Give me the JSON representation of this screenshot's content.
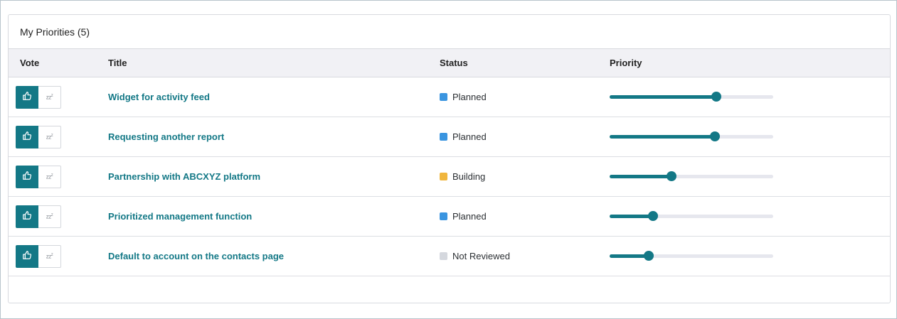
{
  "panel": {
    "title": "My Priorities (5)"
  },
  "columns": {
    "vote": "Vote",
    "title": "Title",
    "status": "Status",
    "priority": "Priority"
  },
  "colors": {
    "accent": "#137886",
    "status_planned": "#3a95e0",
    "status_building": "#f0b63e",
    "status_not_reviewed": "#d5d8de"
  },
  "vote_icons": {
    "up": "thumbs-up-icon",
    "snooze": "snooze-icon",
    "snooze_text": "zz",
    "snooze_sup": "z"
  },
  "rows": [
    {
      "title": "Widget for activity feed",
      "status": "Planned",
      "status_color": "#3a95e0",
      "priority": 0.65
    },
    {
      "title": "Requesting another report",
      "status": "Planned",
      "status_color": "#3a95e0",
      "priority": 0.645
    },
    {
      "title": "Partnership with ABCXYZ platform",
      "status": "Building",
      "status_color": "#f0b63e",
      "priority": 0.38
    },
    {
      "title": "Prioritized management function",
      "status": "Planned",
      "status_color": "#3a95e0",
      "priority": 0.265
    },
    {
      "title": "Default to account on the contacts page",
      "status": "Not Reviewed",
      "status_color": "#d5d8de",
      "priority": 0.24
    }
  ]
}
